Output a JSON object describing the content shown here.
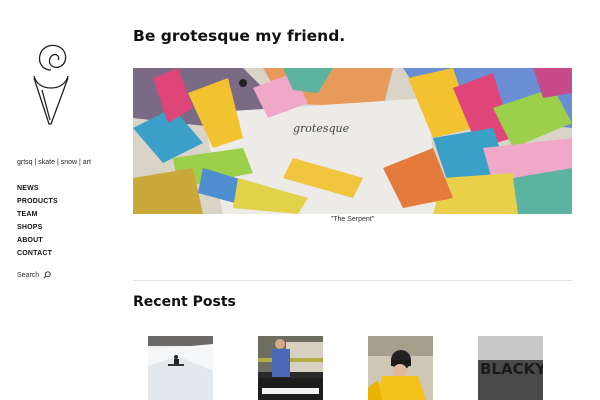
{
  "site": {
    "tagline": "grtsq | skate | snow | art",
    "logo_icon": "spiral-cone-logo-icon"
  },
  "nav": {
    "items": [
      {
        "label": "NEWS"
      },
      {
        "label": "PRODUCTS"
      },
      {
        "label": "TEAM"
      },
      {
        "label": "SHOPS"
      },
      {
        "label": "ABOUT"
      },
      {
        "label": "CONTACT"
      }
    ]
  },
  "search": {
    "label": "Search",
    "icon": "search-icon"
  },
  "main": {
    "title": "Be grotesque my friend.",
    "hero": {
      "caption": "\"The Serpent\"",
      "card_text": "grotesque"
    },
    "recent": {
      "title": "Recent Posts",
      "posts": [
        {
          "image": "snowboarder-on-snow"
        },
        {
          "image": "person-in-blue-shirt-on-stage"
        },
        {
          "image": "person-in-yellow-jacket-and-beanie"
        },
        {
          "image": "blacky-text-photo",
          "overlay_text": "BLACKY"
        }
      ]
    }
  },
  "colors": {
    "text": "#111111",
    "divider": "#e2e2e2",
    "background": "#ffffff"
  }
}
